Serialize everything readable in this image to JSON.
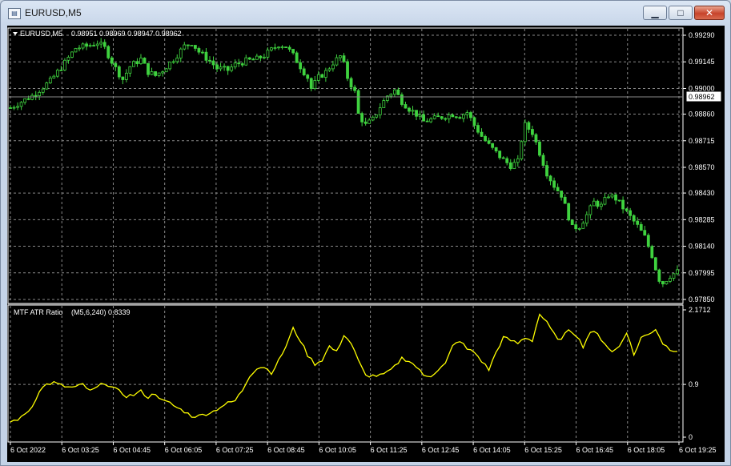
{
  "window": {
    "title": "EURUSD,M5",
    "icon": "chart-window-icon"
  },
  "controls": {
    "minimize": "minimize-icon",
    "maximize": "maximize-icon",
    "close": "close-icon",
    "minimize_glyph": "▁",
    "maximize_glyph": "□",
    "close_glyph": "✕"
  },
  "colors": {
    "background": "#000000",
    "candles": "#3fd23f",
    "indicator": "#ffff00",
    "grid": "#8a8a8a",
    "text": "#ffffff"
  },
  "main_chart": {
    "symbol_label": "EURUSD,M5",
    "ohlc_label": "0.98951 0.98969 0.98947 0.98962",
    "current_price": "0.98962",
    "price_ticks": [
      "0.99290",
      "0.99145",
      "0.99000",
      "0.98860",
      "0.98715",
      "0.98570",
      "0.98430",
      "0.98285",
      "0.98140",
      "0.97995",
      "0.97850"
    ]
  },
  "sub_chart": {
    "label": "MTF ATR Ratio",
    "params": "(M5,6,240) 0.8339",
    "ticks": [
      "2.1712",
      "0.9",
      "0"
    ]
  },
  "time_ticks": [
    "6 Oct 2022",
    "6 Oct 03:25",
    "6 Oct 04:45",
    "6 Oct 06:05",
    "6 Oct 07:25",
    "6 Oct 08:45",
    "6 Oct 10:05",
    "6 Oct 11:25",
    "6 Oct 12:45",
    "6 Oct 14:05",
    "6 Oct 15:25",
    "6 Oct 16:45",
    "6 Oct 18:05",
    "6 Oct 19:25"
  ],
  "chart_data": [
    {
      "type": "candlestick",
      "title": "EURUSD,M5",
      "ylim": [
        0.9785,
        0.9929
      ],
      "y_ticks": [
        0.9929,
        0.99145,
        0.99,
        0.9886,
        0.98715,
        0.9857,
        0.9843,
        0.98285,
        0.9814,
        0.97995,
        0.9785
      ],
      "close_path": [
        [
          0,
          0.98895
        ],
        [
          6,
          0.9896
        ],
        [
          11,
          0.9904
        ],
        [
          15,
          0.9914
        ],
        [
          18,
          0.9922
        ],
        [
          21,
          0.9923
        ],
        [
          24,
          0.9925
        ],
        [
          26,
          0.9922
        ],
        [
          29,
          0.9911
        ],
        [
          31,
          0.9905
        ],
        [
          33,
          0.9912
        ],
        [
          36,
          0.9916
        ],
        [
          38,
          0.9909
        ],
        [
          40,
          0.9907
        ],
        [
          42,
          0.991
        ],
        [
          45,
          0.9916
        ],
        [
          48,
          0.9923
        ],
        [
          50,
          0.9925
        ],
        [
          52,
          0.992
        ],
        [
          55,
          0.9915
        ],
        [
          57,
          0.9911
        ],
        [
          60,
          0.991
        ],
        [
          62,
          0.9913
        ],
        [
          65,
          0.9915
        ],
        [
          68,
          0.9916
        ],
        [
          70,
          0.9918
        ],
        [
          72,
          0.9921
        ],
        [
          74,
          0.9924
        ],
        [
          76,
          0.9923
        ],
        [
          78,
          0.9918
        ],
        [
          80,
          0.9912
        ],
        [
          82,
          0.9906
        ],
        [
          83,
          0.99
        ],
        [
          85,
          0.9906
        ],
        [
          87,
          0.9909
        ],
        [
          89,
          0.9914
        ],
        [
          91,
          0.99175
        ],
        [
          92,
          0.9913
        ],
        [
          93,
          0.9906
        ],
        [
          95,
          0.9898
        ],
        [
          96,
          0.9886
        ],
        [
          98,
          0.988
        ],
        [
          100,
          0.9883
        ],
        [
          102,
          0.989
        ],
        [
          104,
          0.9896
        ],
        [
          106,
          0.9899
        ],
        [
          108,
          0.9893
        ],
        [
          110,
          0.9889
        ],
        [
          112,
          0.9886
        ],
        [
          114,
          0.9882
        ],
        [
          116,
          0.9883
        ],
        [
          118,
          0.9884
        ],
        [
          120,
          0.9885
        ],
        [
          122,
          0.9886
        ],
        [
          124,
          0.9885
        ],
        [
          126,
          0.9887
        ],
        [
          128,
          0.988
        ],
        [
          130,
          0.9874
        ],
        [
          132,
          0.9869
        ],
        [
          134,
          0.9865
        ],
        [
          136,
          0.9861
        ],
        [
          138,
          0.9858
        ],
        [
          140,
          0.986
        ],
        [
          141,
          0.9872
        ],
        [
          142,
          0.988
        ],
        [
          144,
          0.9876
        ],
        [
          146,
          0.9865
        ],
        [
          148,
          0.9854
        ],
        [
          150,
          0.9847
        ],
        [
          152,
          0.9842
        ],
        [
          153,
          0.9836
        ],
        [
          154,
          0.983
        ],
        [
          155,
          0.9824
        ],
        [
          157,
          0.9825
        ],
        [
          159,
          0.9831
        ],
        [
          161,
          0.9838
        ],
        [
          163,
          0.9836
        ],
        [
          165,
          0.9842
        ],
        [
          167,
          0.984
        ],
        [
          169,
          0.9835
        ],
        [
          171,
          0.983
        ],
        [
          173,
          0.9825
        ],
        [
          175,
          0.9819
        ],
        [
          177,
          0.9809
        ],
        [
          178,
          0.9802
        ],
        [
          179,
          0.9796
        ],
        [
          180,
          0.9794
        ],
        [
          182,
          0.9798
        ],
        [
          184,
          0.98
        ]
      ]
    },
    {
      "type": "line",
      "title": "MTF ATR Ratio",
      "ylim": [
        0,
        2.1712
      ],
      "y_ticks": [
        2.1712,
        0.9,
        0
      ],
      "x": [
        0,
        3,
        6,
        8,
        10,
        12,
        14,
        16,
        18,
        20,
        22,
        24,
        26,
        28,
        30,
        32,
        34,
        36,
        38,
        40,
        42,
        44,
        46,
        48,
        50,
        52,
        54,
        56,
        58,
        60,
        62,
        64,
        66,
        68,
        70,
        72,
        74,
        76,
        78,
        80,
        82,
        84,
        86,
        88,
        90,
        92,
        94,
        96,
        98,
        100,
        102,
        104,
        106,
        108,
        110,
        112,
        114,
        116,
        118,
        120,
        122,
        124,
        126,
        128,
        130,
        132,
        134,
        136,
        138,
        140,
        142,
        144,
        146,
        148,
        150,
        152,
        154,
        156,
        158,
        160,
        162,
        164,
        166,
        168,
        170,
        172,
        174,
        176,
        178,
        180,
        182,
        184
      ],
      "values": [
        0.26,
        0.33,
        0.52,
        0.8,
        0.9,
        0.93,
        0.88,
        0.85,
        0.85,
        0.9,
        0.78,
        0.85,
        0.93,
        0.85,
        0.78,
        0.7,
        0.72,
        0.78,
        0.68,
        0.75,
        0.62,
        0.58,
        0.5,
        0.44,
        0.36,
        0.36,
        0.4,
        0.44,
        0.52,
        0.58,
        0.62,
        0.8,
        1.05,
        1.18,
        1.2,
        1.1,
        1.3,
        1.55,
        1.85,
        1.65,
        1.4,
        1.25,
        1.32,
        1.55,
        1.45,
        1.75,
        1.6,
        1.3,
        1.05,
        1.05,
        1.05,
        1.1,
        1.2,
        1.35,
        1.3,
        1.2,
        1.05,
        1.05,
        1.15,
        1.25,
        1.55,
        1.65,
        1.5,
        1.45,
        1.3,
        1.15,
        1.45,
        1.7,
        1.65,
        1.6,
        1.7,
        1.65,
        2.1,
        1.95,
        1.75,
        1.65,
        1.85,
        1.75,
        1.55,
        1.8,
        1.75,
        1.6,
        1.45,
        1.55,
        1.8,
        1.4,
        1.7,
        1.75,
        1.85,
        1.6,
        1.5,
        1.48
      ]
    }
  ]
}
